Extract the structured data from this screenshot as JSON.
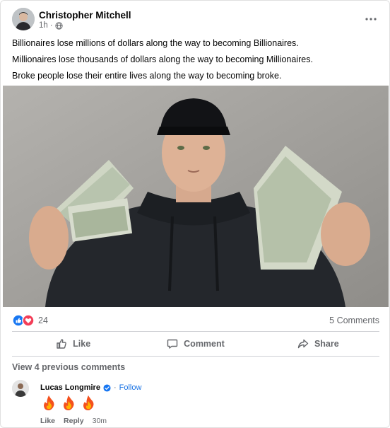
{
  "post": {
    "author": "Christopher Mitchell",
    "time": "1h",
    "separator": "·",
    "more_label": "•••",
    "lines": [
      "Billionaires lose millions of dollars along the way to becoming Billionaires.",
      "Millionaires lose thousands of dollars along the way to becoming Millionaires.",
      "Broke people lose their entire lives along the way to becoming broke."
    ]
  },
  "stats": {
    "reactions_count": "24",
    "comments_count": "5 Comments"
  },
  "actions": {
    "like": "Like",
    "comment": "Comment",
    "share": "Share"
  },
  "comments_section": {
    "view_previous": "View 4 previous comments"
  },
  "comment": {
    "author": "Lucas Longmire",
    "follow": "Follow",
    "separator": "·",
    "text": "🔥🔥🔥",
    "like": "Like",
    "reply": "Reply",
    "time": "30m"
  },
  "colors": {
    "like_blue": "#1877f2",
    "love_red": "#f33e58",
    "link_blue": "#1b74e4",
    "muted": "#65676b"
  },
  "icons": [
    "globe-icon",
    "more-icon",
    "like-reaction-icon",
    "love-reaction-icon",
    "thumbs-up-icon",
    "comment-icon",
    "share-icon",
    "verified-badge-icon",
    "fire-emoji"
  ]
}
